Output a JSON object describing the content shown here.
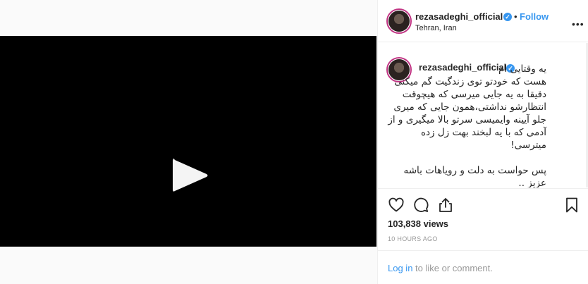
{
  "media": {
    "icons": {
      "play": "play-icon"
    }
  },
  "header": {
    "username": "rezasadeghi_official",
    "verified": "✓",
    "separator": "•",
    "follow_label": "Follow",
    "location": "Tehran, Iran",
    "more_label": "•••"
  },
  "comment": {
    "username": "rezasadeghi_official",
    "lines": [
      "یه وقتایی ام",
      "هست که خودتو توی زندگیت گم میکنی",
      "دقیقا به یه جایی میرسی که هیچوقت",
      "انتظارشو نداشتی،همون جایی که میری",
      "جلو آیینه وایمیسی سرتو بالا میگیری و از",
      "آدمی که با یه لبخند بهت زل زده",
      "میترسی!",
      "",
      "پس حواست به دلت و رویاهات باشه",
      "عزیز ..",
      "."
    ]
  },
  "actions": {
    "icons": [
      "heart-icon",
      "comment-icon",
      "share-icon",
      "bookmark-icon"
    ],
    "views": "103,838 views",
    "time": "10 HOURS AGO"
  },
  "login": {
    "link": "Log in",
    "rest": " to like or comment."
  },
  "colors": {
    "accent": "#3897f0",
    "ring": "#c13584",
    "muted": "#999999"
  }
}
